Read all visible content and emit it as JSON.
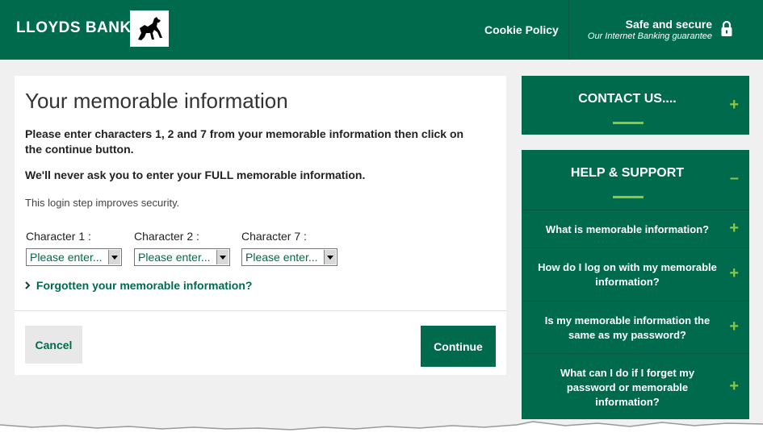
{
  "header": {
    "brand": "LLOYDS BANK",
    "cookie_link": "Cookie Policy",
    "secure_title": "Safe and secure",
    "secure_subtitle": "Our Internet Banking guarantee",
    "lock_icon": "lock-icon",
    "logo_icon": "horse-logo-icon"
  },
  "main": {
    "title": "Your memorable information",
    "instructions": "Please enter characters 1, 2 and 7 from your memorable information then click on the continue button.",
    "warning": "We'll never ask you to enter your FULL memorable information.",
    "security_note": "This login step improves security.",
    "fields": [
      {
        "label": "Character 1 :",
        "value": "Please enter..."
      },
      {
        "label": "Character 2 :",
        "value": "Please enter..."
      },
      {
        "label": "Character 7 :",
        "value": "Please enter..."
      }
    ],
    "forgot_link": "Forgotten your memorable information?",
    "cancel_label": "Cancel",
    "continue_label": "Continue"
  },
  "sidebar": {
    "contact_title": "CONTACT US....",
    "help_title": "HELP & SUPPORT",
    "faqs": [
      "What is memorable information?",
      "How do I log on with my memorable information?",
      "Is my memorable information the same as my password?",
      "What can I do if I forget my password or memorable information?"
    ],
    "plus_symbol": "+",
    "minus_symbol": "–"
  },
  "colors": {
    "brand_green": "#006a4d",
    "accent_green": "#8dc63f"
  }
}
